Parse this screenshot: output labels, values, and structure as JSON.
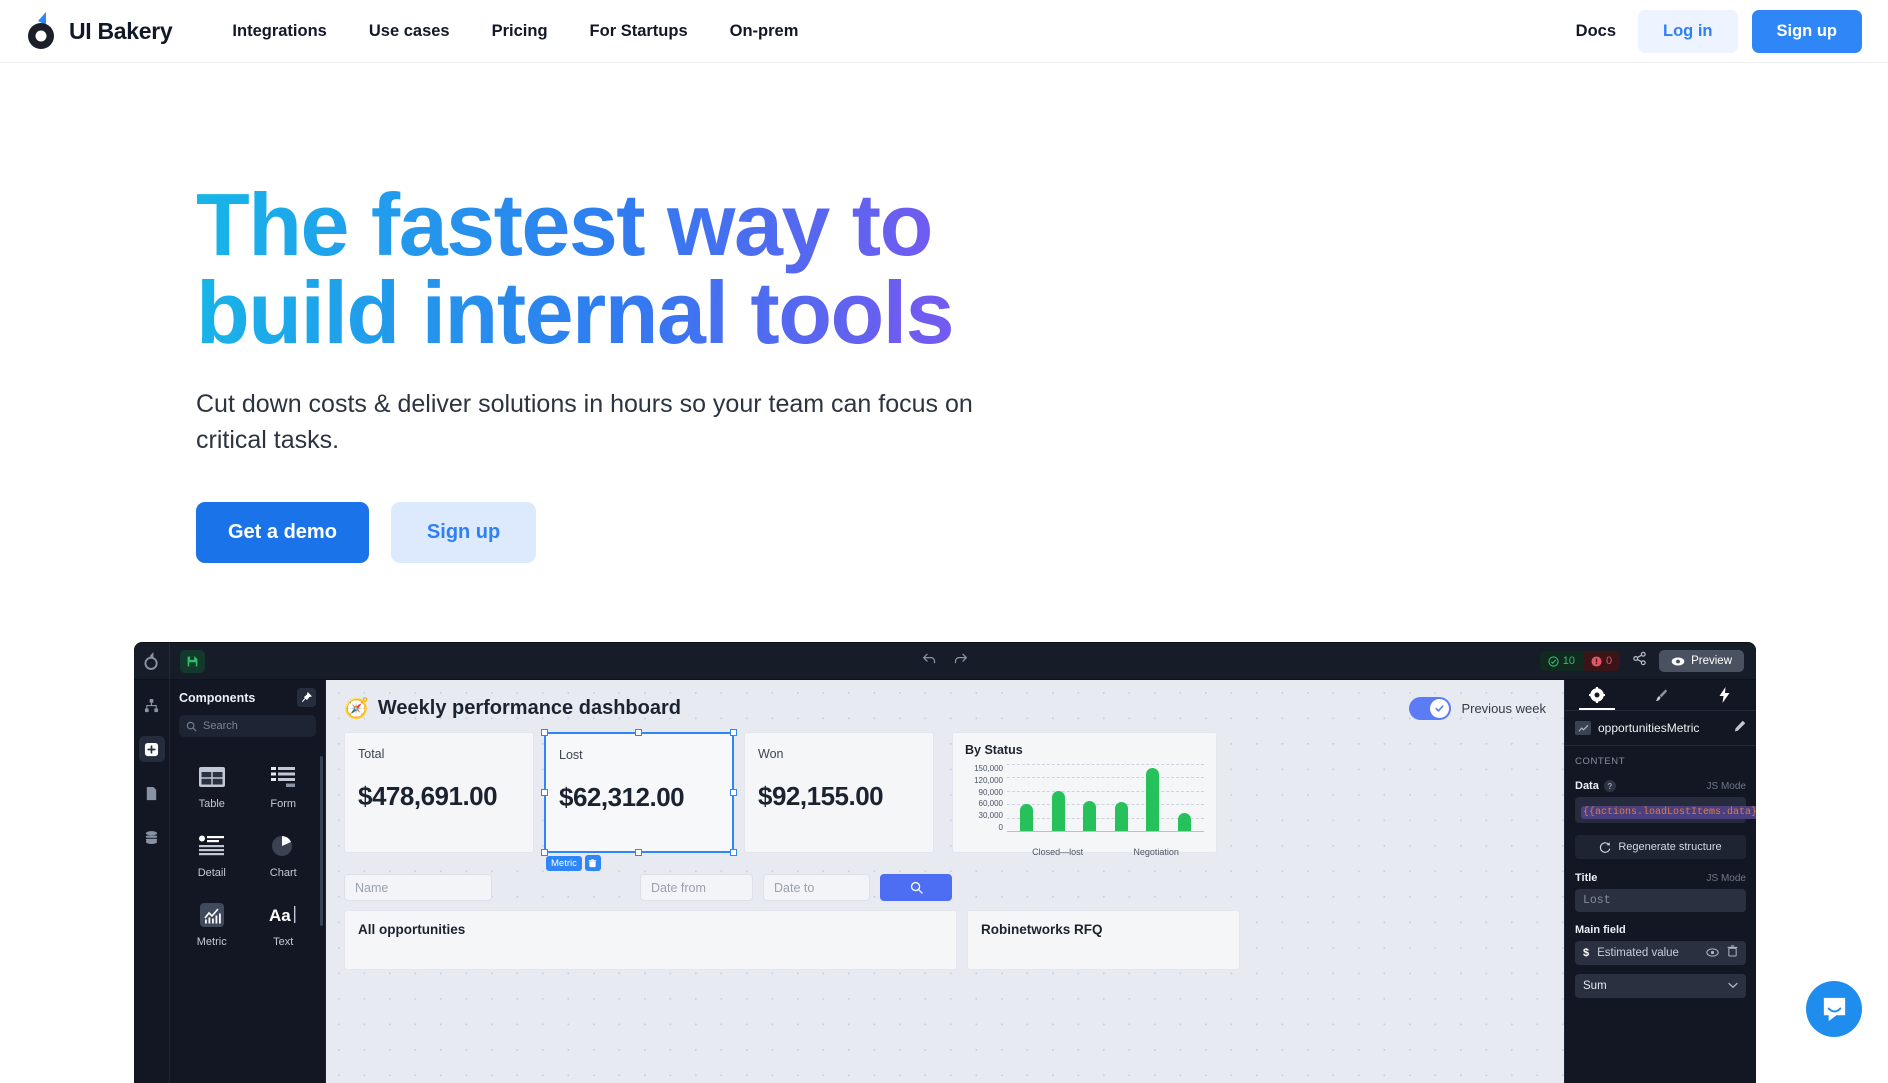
{
  "nav": {
    "brand": "UI Bakery",
    "links": [
      "Integrations",
      "Use cases",
      "Pricing",
      "For Startups",
      "On-prem"
    ],
    "docs": "Docs",
    "login": "Log in",
    "signup": "Sign up"
  },
  "hero": {
    "title_line1": "The fastest way to",
    "title_line2": "build internal tools",
    "subtitle": "Cut down costs & deliver solutions in hours so your team can focus on critical tasks.",
    "cta_primary": "Get a demo",
    "cta_secondary": "Sign up",
    "gradient_from": "#17b6e8",
    "gradient_to": "#8a5cf5"
  },
  "app": {
    "topbar": {
      "status_ok": "10",
      "status_error": "0",
      "preview": "Preview"
    },
    "components_panel": {
      "title": "Components",
      "search_placeholder": "Search",
      "items": [
        {
          "label": "Table",
          "icon": "table-icon"
        },
        {
          "label": "Form",
          "icon": "form-icon"
        },
        {
          "label": "Detail",
          "icon": "detail-icon"
        },
        {
          "label": "Chart",
          "icon": "chart-icon"
        },
        {
          "label": "Metric",
          "icon": "metric-icon"
        },
        {
          "label": "Text",
          "icon": "text-icon"
        }
      ]
    },
    "canvas": {
      "dashboard_title": "Weekly performance dashboard",
      "dashboard_emoji": "🧭",
      "toggle_label": "Previous week",
      "metrics": [
        {
          "label": "Total",
          "value": "$478,691.00",
          "selected": false
        },
        {
          "label": "Lost",
          "value": "$62,312.00",
          "selected": true
        },
        {
          "label": "Won",
          "value": "$92,155.00",
          "selected": false
        }
      ],
      "selection_tag": "Metric",
      "filters": {
        "name_placeholder": "Name",
        "date_from_placeholder": "Date from",
        "date_to_placeholder": "Date to"
      },
      "lists": [
        {
          "title": "All opportunities"
        },
        {
          "title": "Robinetworks RFQ"
        }
      ]
    },
    "properties": {
      "component_name": "opportunitiesMetric",
      "section_label": "CONTENT",
      "data_label": "Data",
      "js_mode": "JS Mode",
      "data_value": "{{actions.loadLostItems.data}}",
      "regenerate": "Regenerate structure",
      "title_label": "Title",
      "title_value": "Lost",
      "main_field_label": "Main field",
      "main_field_value": "Estimated value",
      "main_field_prefix": "$",
      "aggregation": "Sum"
    }
  },
  "chart_data": {
    "type": "bar",
    "title": "By Status",
    "categories": [
      "Closed—lost",
      "",
      "",
      "Negotiation",
      "",
      ""
    ],
    "values": [
      60000,
      90000,
      68000,
      65000,
      140000,
      40000
    ],
    "xlabel": "",
    "ylabel": "",
    "ylim": [
      0,
      150000
    ],
    "yticks": [
      150000,
      120000,
      90000,
      60000,
      30000,
      0
    ],
    "ytick_labels": [
      "150,000",
      "120,000",
      "90,000",
      "60,000",
      "30,000",
      "0"
    ],
    "xtick_labels": [
      "Closed—lost",
      "Negotiation"
    ],
    "bar_color": "#27c15c",
    "grid": true,
    "legend": false
  }
}
